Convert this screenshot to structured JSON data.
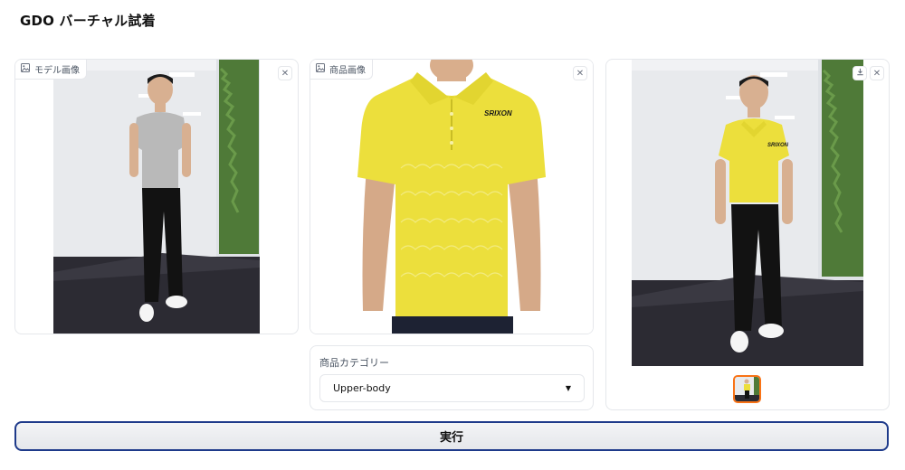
{
  "app": {
    "title": "GDO バーチャル試着"
  },
  "model_panel": {
    "label": "モデル画像",
    "clear_icon": "close-icon",
    "image_icon": "image-icon"
  },
  "garment_panel": {
    "label": "商品画像",
    "clear_icon": "close-icon",
    "image_icon": "image-icon",
    "logo_text": "SRIXON"
  },
  "result_panel": {
    "download_icon": "download-icon",
    "clear_icon": "close-icon",
    "logo_text": "SRIXON"
  },
  "category": {
    "label": "商品カテゴリー",
    "selected": "Upper-body",
    "caret_icon": "caret-down-icon"
  },
  "actions": {
    "run_label": "実行"
  },
  "colors": {
    "accent_border": "#1e3a8a",
    "thumb_border": "#f97316",
    "shirt_yellow": "#ecdf3c",
    "grey_tshirt": "#b9b9b9"
  }
}
